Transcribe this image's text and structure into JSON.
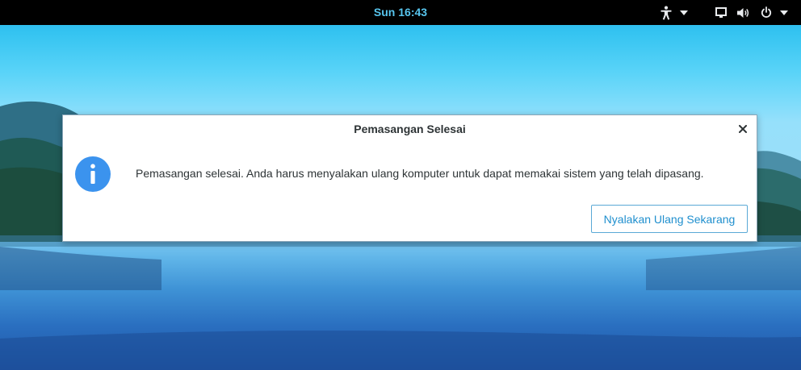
{
  "topbar": {
    "clock": "Sun 16:43",
    "accessibility_icon": "accessibility-icon",
    "accessibility_menu_icon": "chevron-down-icon",
    "screen_icon": "screen-icon",
    "volume_icon": "volume-icon",
    "power_icon": "power-icon",
    "system_menu_icon": "chevron-down-icon"
  },
  "dialog": {
    "title": "Pemasangan Selesai",
    "close_icon": "close-icon",
    "info_icon": "info-icon",
    "message": "Pemasangan selesai. Anda harus menyalakan ulang komputer untuk dapat memakai sistem yang telah dipasang.",
    "restart_button_label": "Nyalakan Ulang Sekarang"
  },
  "colors": {
    "topbar_background": "#000000",
    "clock_text": "#57c5ee",
    "dialog_background": "#ffffff",
    "info_icon_background": "#3b93ee",
    "button_text": "#1f8fce",
    "button_border": "#5aa9d6"
  }
}
